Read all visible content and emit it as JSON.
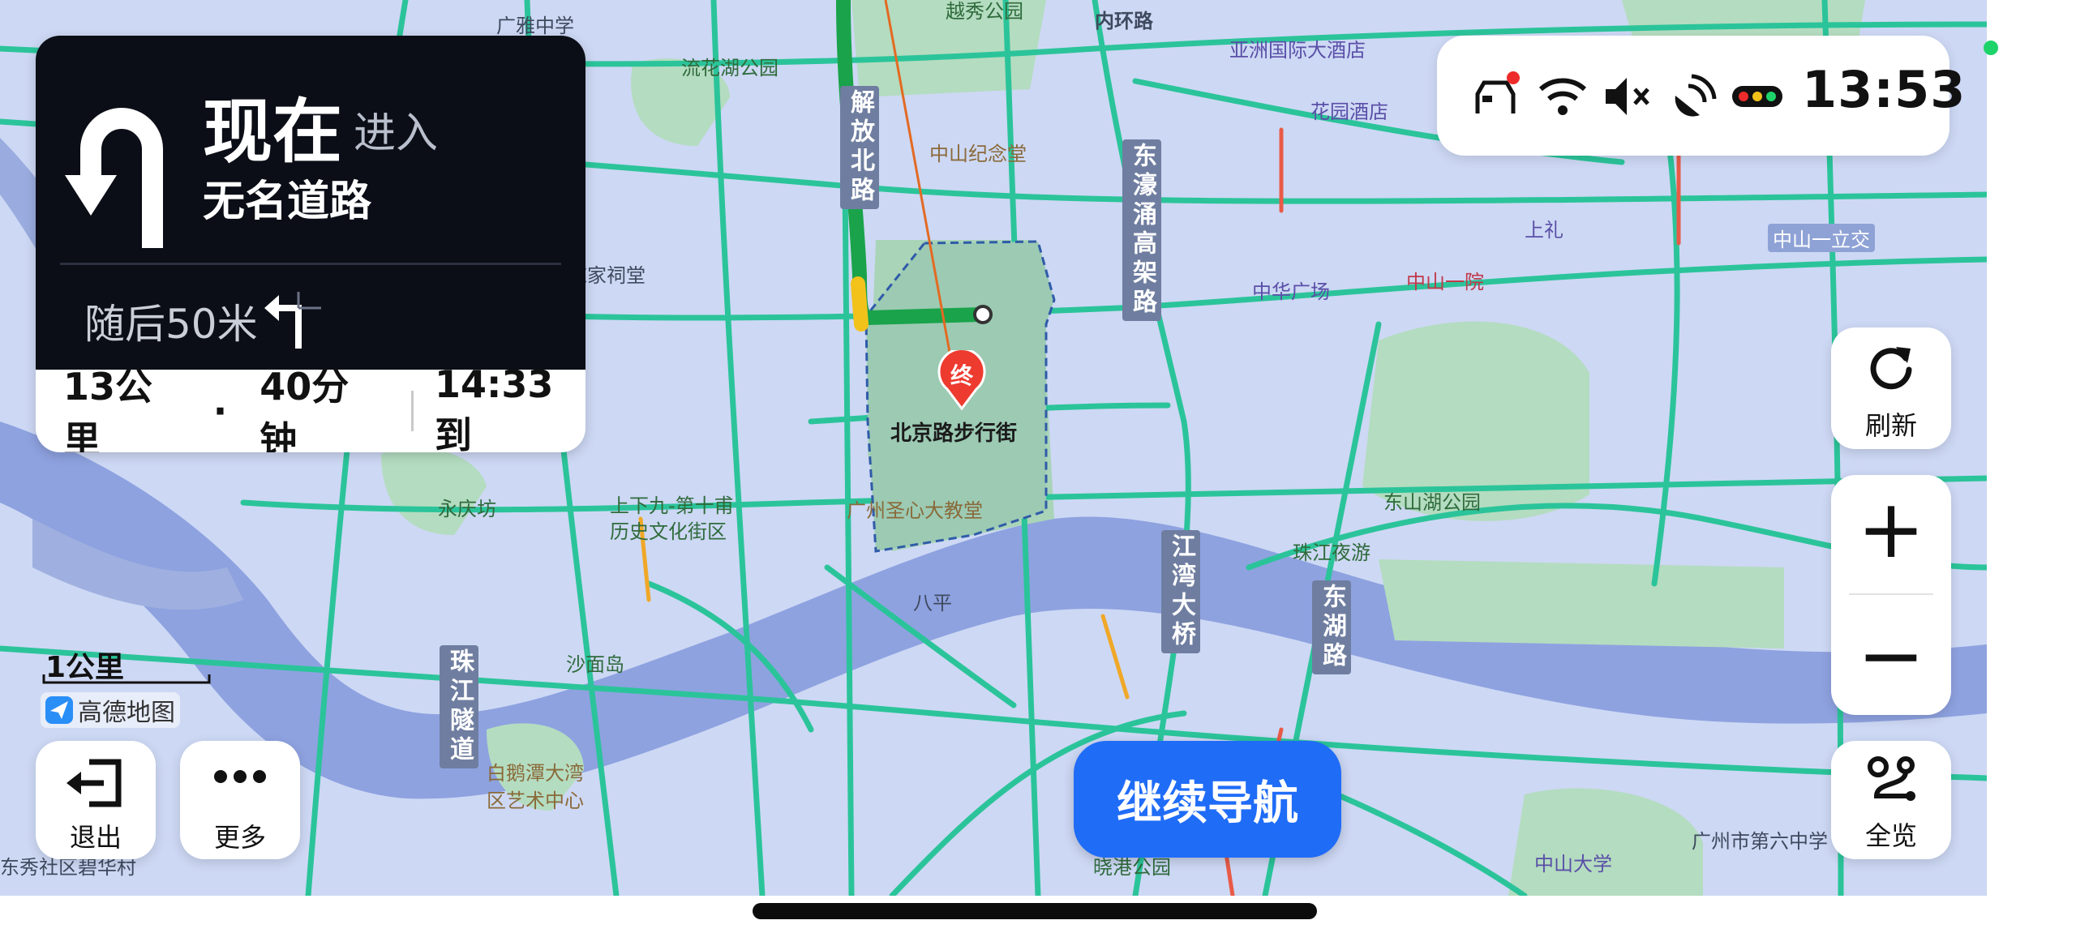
{
  "navigation": {
    "now_label": "现在",
    "action_label": "进入",
    "road_name": "无名道路",
    "then_label": "随后50米",
    "distance": "13公里",
    "separator": "·",
    "duration": "40分钟",
    "arrival": "14:33到"
  },
  "status_bar": {
    "time": "13:53",
    "icons": [
      "car-connection-icon",
      "wifi-icon",
      "mute-icon",
      "satellite-icon",
      "traffic-light-icon"
    ]
  },
  "map_controls": {
    "refresh_label": "刷新",
    "zoom_in_symbol": "+",
    "zoom_out_symbol": "−",
    "overview_label": "全览"
  },
  "bottom_left": {
    "exit_label": "退出",
    "more_label": "更多",
    "scale_label": "1公里",
    "brand_label": "高德地图"
  },
  "continue_button": {
    "label": "继续导航"
  },
  "destination": {
    "pin_label": "终",
    "name": "北京路步行街"
  },
  "map_labels": {
    "guangya": "广雅中学",
    "yuexiu_park": "越秀公园",
    "inner_ring": "内环路",
    "asia_hotel": "亚洲国际大酒店",
    "liuhua_park": "流花湖公园",
    "garden_hotel": "花园酒店",
    "zhongshan_hall": "中山纪念堂",
    "jiefang_road": "解放北路",
    "dongqiao_road": "东濠涌高架路",
    "shangli": "上礼",
    "zhongshan_overpass": "中山一立交",
    "chen_temple": "陈家祠堂",
    "zhonghua_plaza": "中华广场",
    "zhongshan_hospital": "中山一院",
    "yongqingfang": "永庆坊",
    "shangxiajiu_1": "上下九-第十甫",
    "shangxiajiu_2": "历史文化街区",
    "cathedral": "广州圣心大教堂",
    "donghu_park": "东山湖公园",
    "zhujiang_night": "珠江夜游",
    "haizhu_bridge": "江湾大桥",
    "donghu_road": "东湖路",
    "baping": "八平",
    "shamian": "沙面岛",
    "tunnel": "珠江隧道",
    "baietan_1": "白鹅潭大湾",
    "baietan_2": "区艺术中心",
    "sun_yatsen_univ": "中山大学",
    "no6_school": "广州市第六中学",
    "xiaogang_park": "晓港公园",
    "dongxiu": "东秀社区碧华村"
  },
  "colors": {
    "water": "#8ea2e0",
    "land": "#cdd8f4",
    "green_area": "#b4dcc0",
    "road_clear": "#2bc49a",
    "route": "#1aa34a",
    "accent_blue": "#1f6cf7",
    "nav_dark": "#0b0e16"
  }
}
